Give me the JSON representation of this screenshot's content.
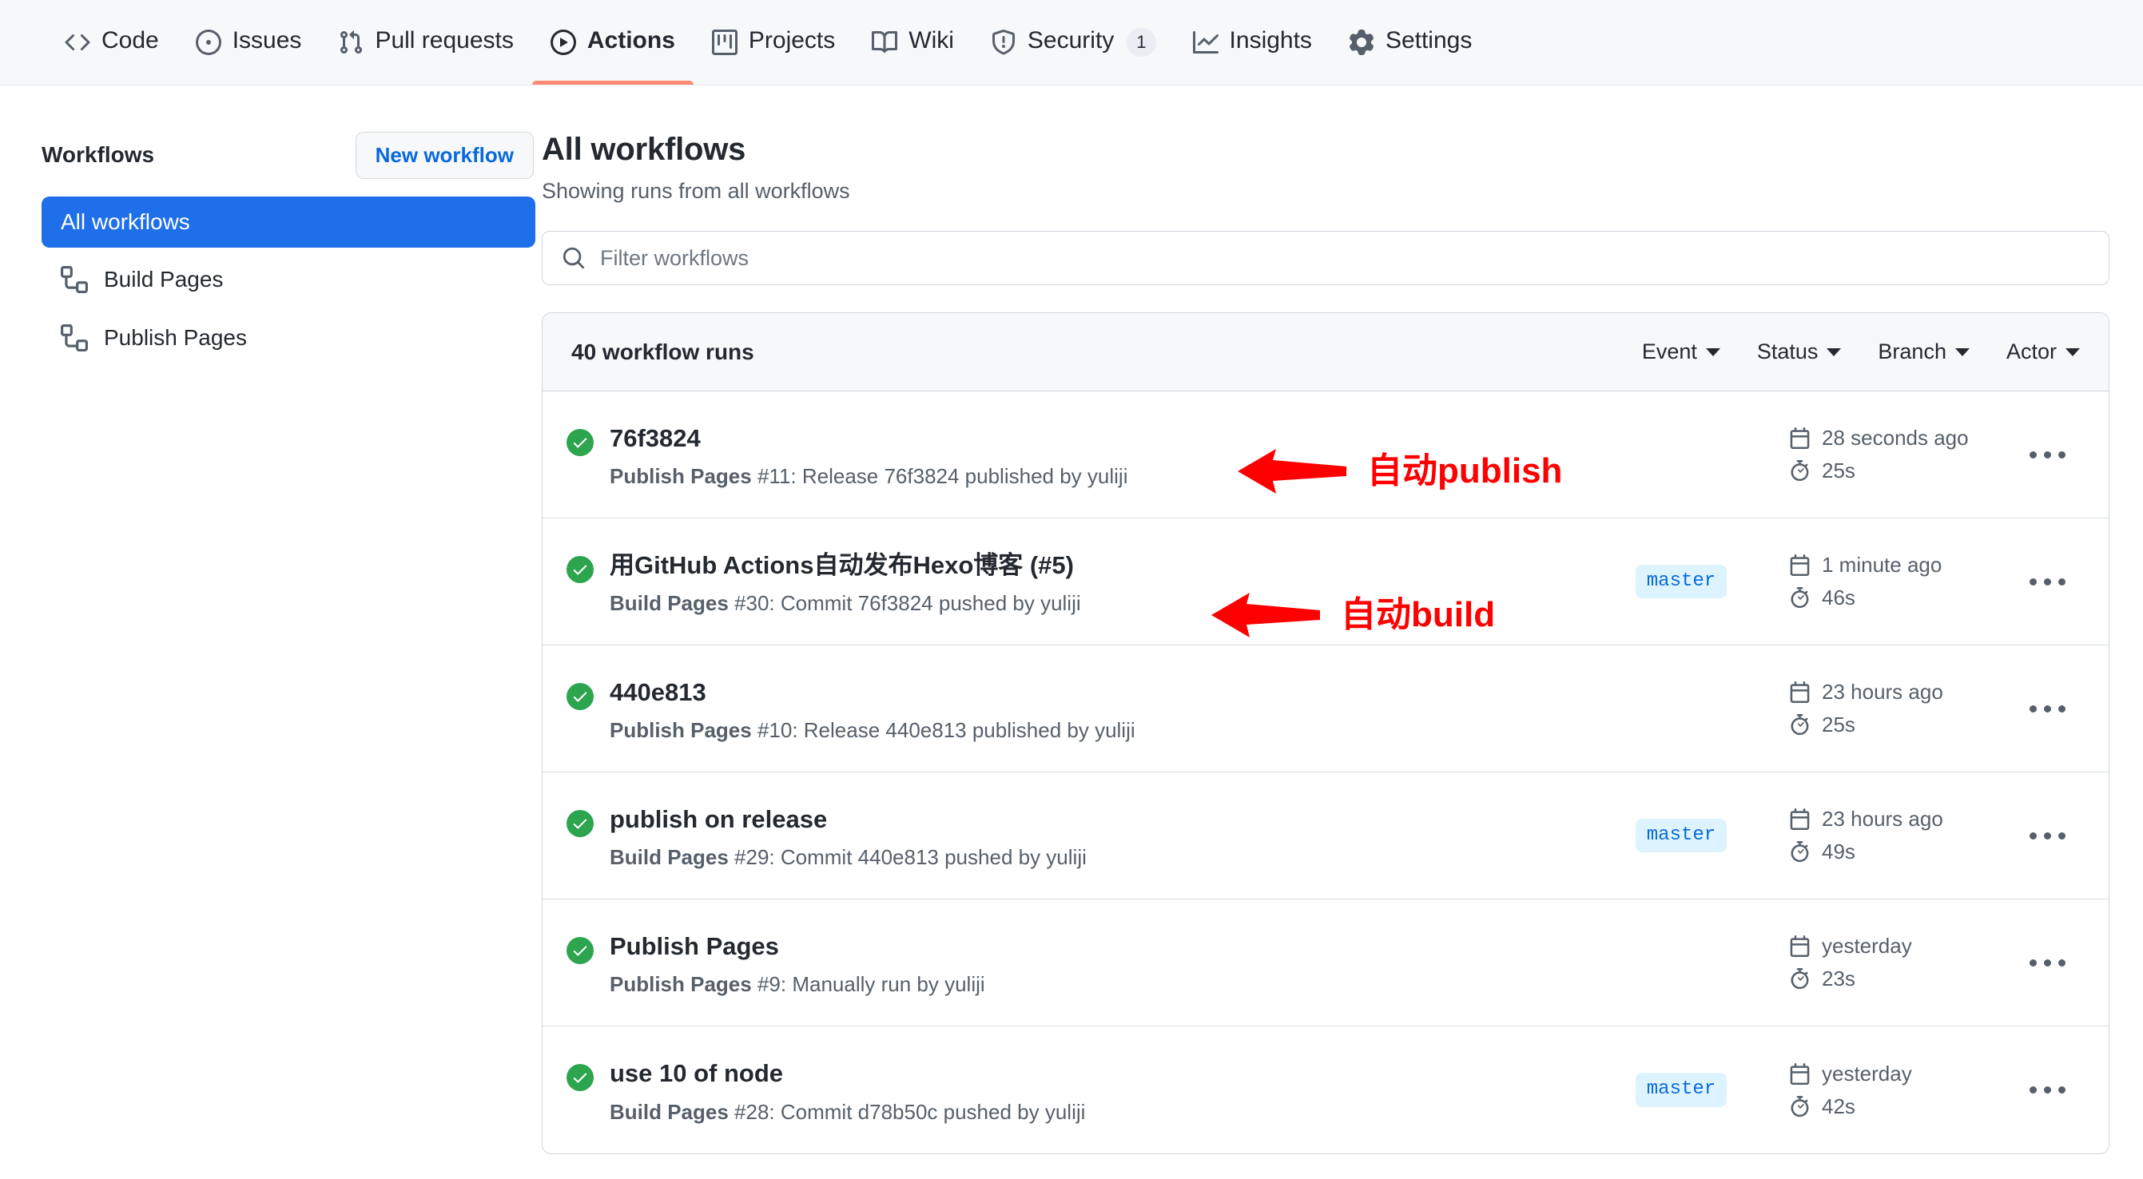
{
  "repo_nav": {
    "items": [
      {
        "label": "Code",
        "icon": "code-icon",
        "active": false,
        "counter": null
      },
      {
        "label": "Issues",
        "icon": "issue-opened-icon",
        "active": false,
        "counter": null
      },
      {
        "label": "Pull requests",
        "icon": "git-pull-request-icon",
        "active": false,
        "counter": null
      },
      {
        "label": "Actions",
        "icon": "play-icon",
        "active": true,
        "counter": null
      },
      {
        "label": "Projects",
        "icon": "project-icon",
        "active": false,
        "counter": null
      },
      {
        "label": "Wiki",
        "icon": "book-icon",
        "active": false,
        "counter": null
      },
      {
        "label": "Security",
        "icon": "shield-icon",
        "active": false,
        "counter": "1"
      },
      {
        "label": "Insights",
        "icon": "graph-icon",
        "active": false,
        "counter": null
      },
      {
        "label": "Settings",
        "icon": "gear-icon",
        "active": false,
        "counter": null
      }
    ],
    "active_underline_color": "#fd8c73"
  },
  "sidebar": {
    "title": "Workflows",
    "new_workflow_label": "New workflow",
    "selected_color": "#1f6feb",
    "items": [
      {
        "label": "All workflows",
        "icon": null,
        "selected": true
      },
      {
        "label": "Build Pages",
        "icon": "workflow-icon",
        "selected": false
      },
      {
        "label": "Publish Pages",
        "icon": "workflow-icon",
        "selected": false
      }
    ]
  },
  "main": {
    "title": "All workflows",
    "subtitle": "Showing runs from all workflows",
    "filter": {
      "placeholder": "Filter workflows",
      "value": "",
      "icon": "search-icon"
    },
    "runs_header": {
      "count_label": "40 workflow runs",
      "filters": [
        {
          "label": "Event"
        },
        {
          "label": "Status"
        },
        {
          "label": "Branch"
        },
        {
          "label": "Actor"
        }
      ]
    },
    "runs": [
      {
        "status": "success",
        "title": "76f3824",
        "workflow": "Publish Pages",
        "detail": " #11: Release 76f3824 published by yuliji",
        "branch": null,
        "time": "28 seconds ago",
        "duration": "25s"
      },
      {
        "status": "success",
        "title": "用GitHub Actions自动发布Hexo博客 (#5)",
        "workflow": "Build Pages",
        "detail": " #30: Commit 76f3824 pushed by yuliji",
        "branch": "master",
        "time": "1 minute ago",
        "duration": "46s"
      },
      {
        "status": "success",
        "title": "440e813",
        "workflow": "Publish Pages",
        "detail": " #10: Release 440e813 published by yuliji",
        "branch": null,
        "time": "23 hours ago",
        "duration": "25s"
      },
      {
        "status": "success",
        "title": "publish on release",
        "workflow": "Build Pages",
        "detail": " #29: Commit 440e813 pushed by yuliji",
        "branch": "master",
        "time": "23 hours ago",
        "duration": "49s"
      },
      {
        "status": "success",
        "title": "Publish Pages",
        "workflow": "Publish Pages",
        "detail": " #9: Manually run by yuliji",
        "branch": null,
        "time": "yesterday",
        "duration": "23s"
      },
      {
        "status": "success",
        "title": "use 10 of node",
        "workflow": "Build Pages",
        "detail": " #28: Commit d78b50c pushed by yuliji",
        "branch": "master",
        "time": "yesterday",
        "duration": "42s"
      }
    ]
  },
  "annotations": {
    "color": "#ff0000",
    "items": [
      {
        "text": "自动publish",
        "target_row": 0
      },
      {
        "text": "自动build",
        "target_row": 1
      }
    ]
  }
}
